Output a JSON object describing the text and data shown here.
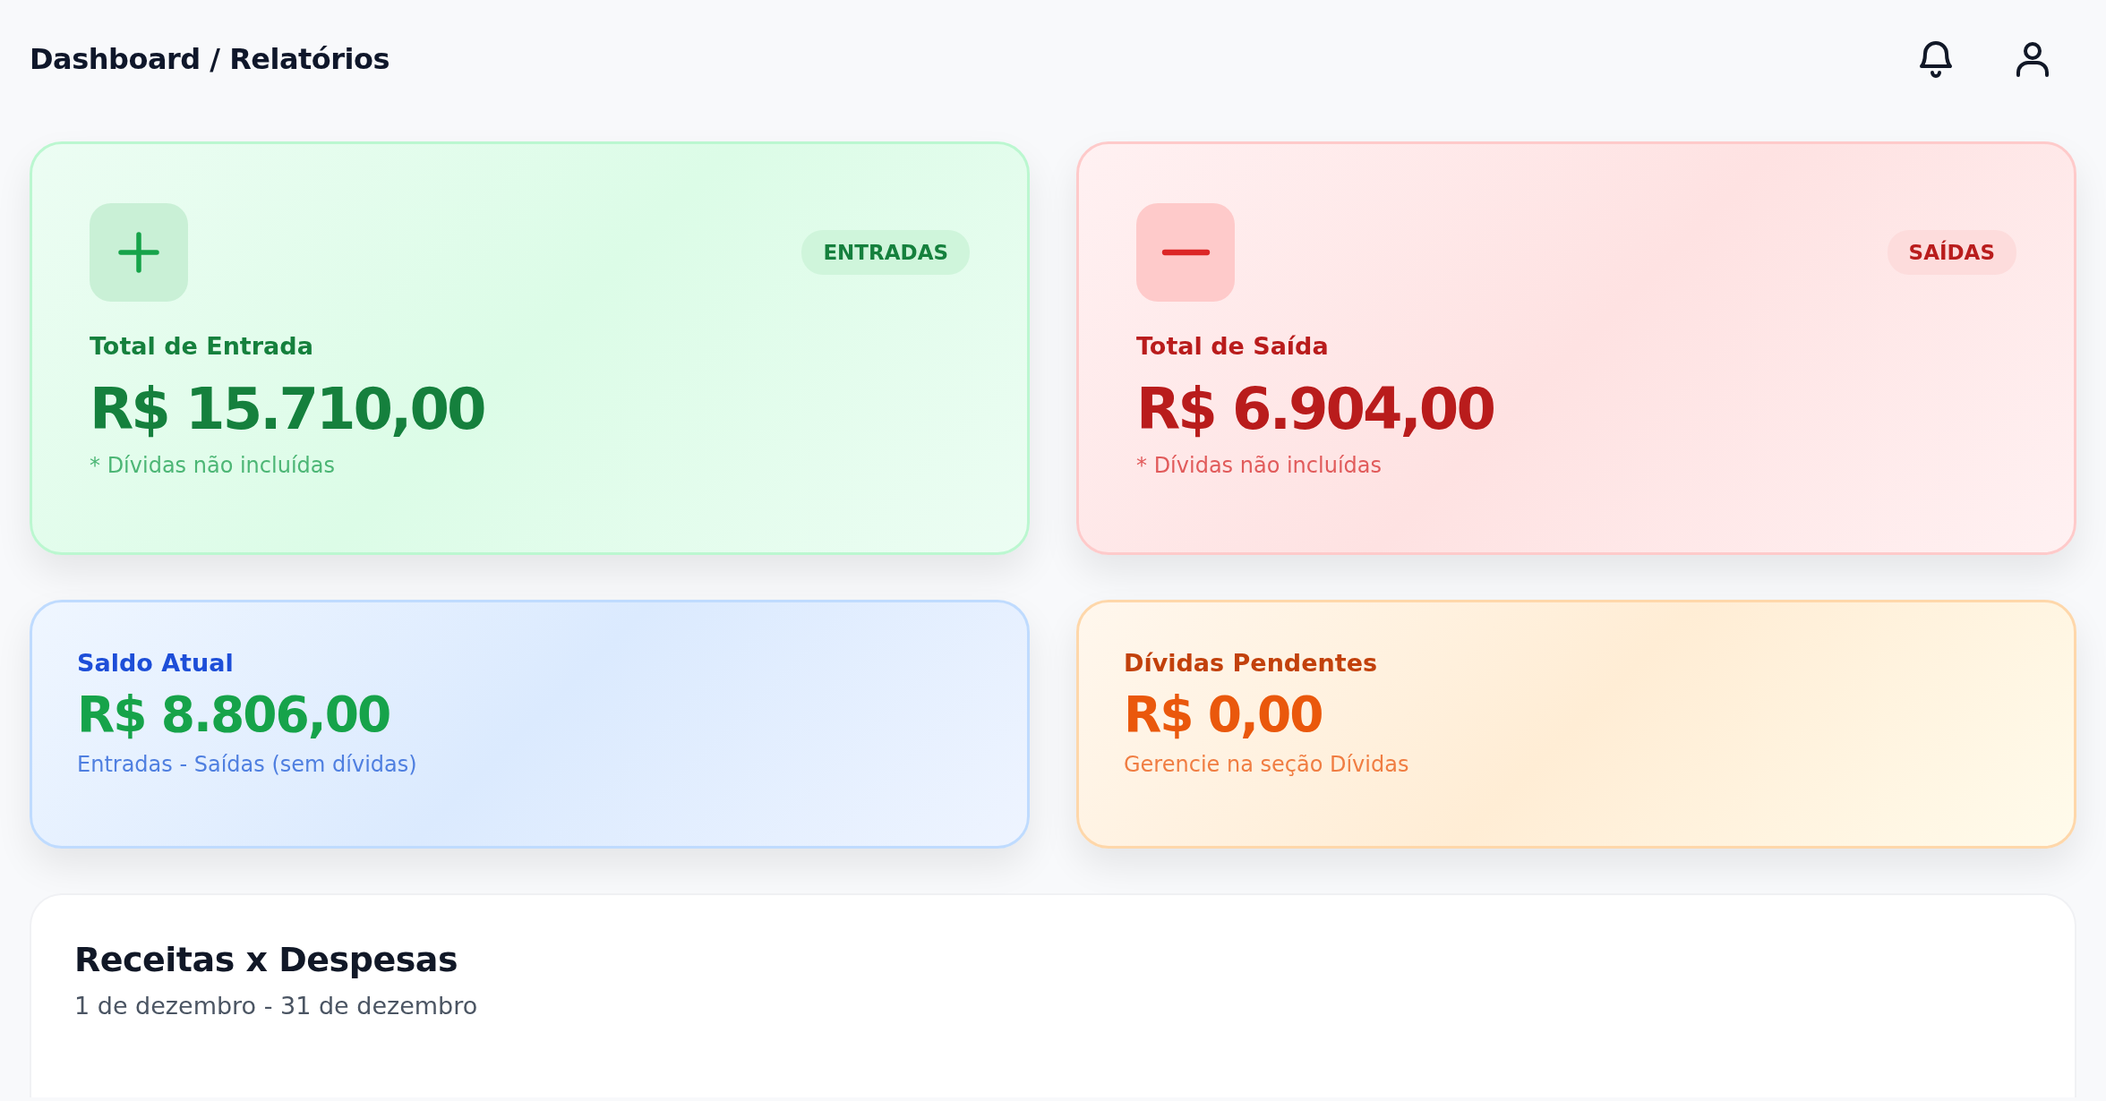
{
  "header": {
    "title": "Dashboard / Relatórios"
  },
  "cards": [
    {
      "kind": "income",
      "badge": "ENTRADAS",
      "label": "Total de Entrada",
      "value": "R$ 15.710,00",
      "note": "* Dívidas não incluídas"
    },
    {
      "kind": "expense",
      "badge": "SAÍDAS",
      "label": "Total de Saída",
      "value": "R$ 6.904,00",
      "note": "* Dívidas não incluídas"
    },
    {
      "kind": "balance",
      "label": "Saldo Atual",
      "value": "R$ 8.806,00",
      "note": "Entradas - Saídas (sem dívidas)"
    },
    {
      "kind": "debt",
      "label": "Dívidas Pendentes",
      "value": "R$ 0,00",
      "note": "Gerencie na seção Dívidas"
    }
  ],
  "chart_panel": {
    "title": "Receitas x Despesas",
    "subtitle": "1 de dezembro - 31 de dezembro"
  }
}
